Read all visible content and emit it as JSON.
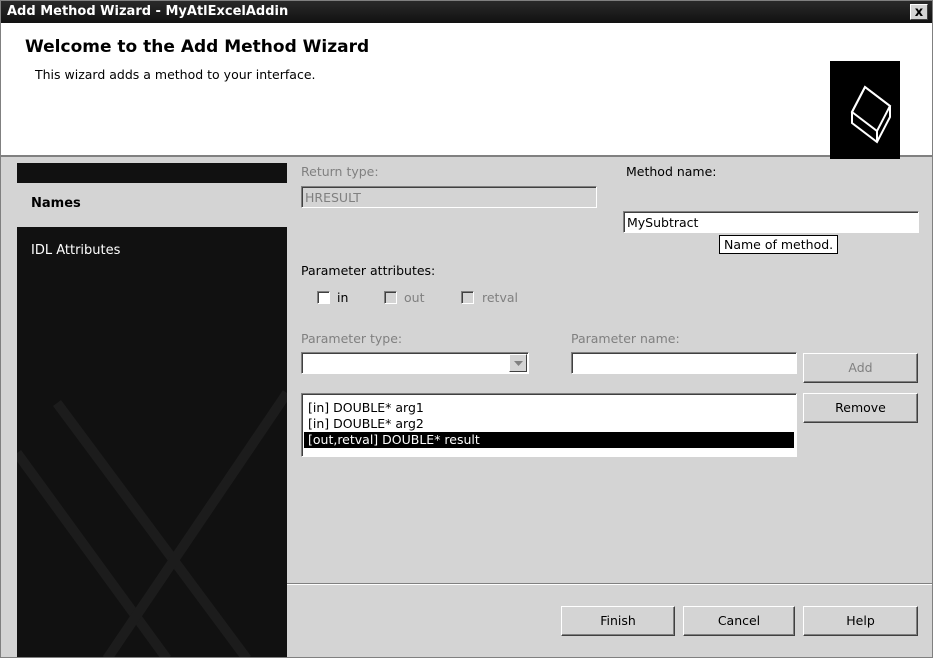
{
  "window": {
    "title": "Add Method Wizard - MyAtlExcelAddin",
    "close_label": "x"
  },
  "header": {
    "title": "Welcome to the Add Method Wizard",
    "subtitle": "This wizard adds a method to your interface."
  },
  "sidebar": {
    "items": [
      {
        "label": "Names",
        "active": true
      },
      {
        "label": "IDL Attributes",
        "active": false
      }
    ]
  },
  "form": {
    "return_type_label": "Return type:",
    "return_type_value": "HRESULT",
    "method_name_label": "Method name:",
    "method_name_value": "MySubtract",
    "tooltip": "Name of method.",
    "param_attrs_label": "Parameter attributes:",
    "attrs": {
      "in": "in",
      "out": "out",
      "retval": "retval"
    },
    "param_type_label": "Parameter type:",
    "param_type_value": "",
    "param_name_label": "Parameter name:",
    "param_name_value": "",
    "add_label": "Add",
    "remove_label": "Remove",
    "params": [
      "[in] DOUBLE* arg1",
      "[in] DOUBLE* arg2",
      "[out,retval] DOUBLE* result"
    ],
    "selected_param_index": 2
  },
  "footer": {
    "finish_label": "Finish",
    "cancel_label": "Cancel",
    "help_label": "Help"
  }
}
